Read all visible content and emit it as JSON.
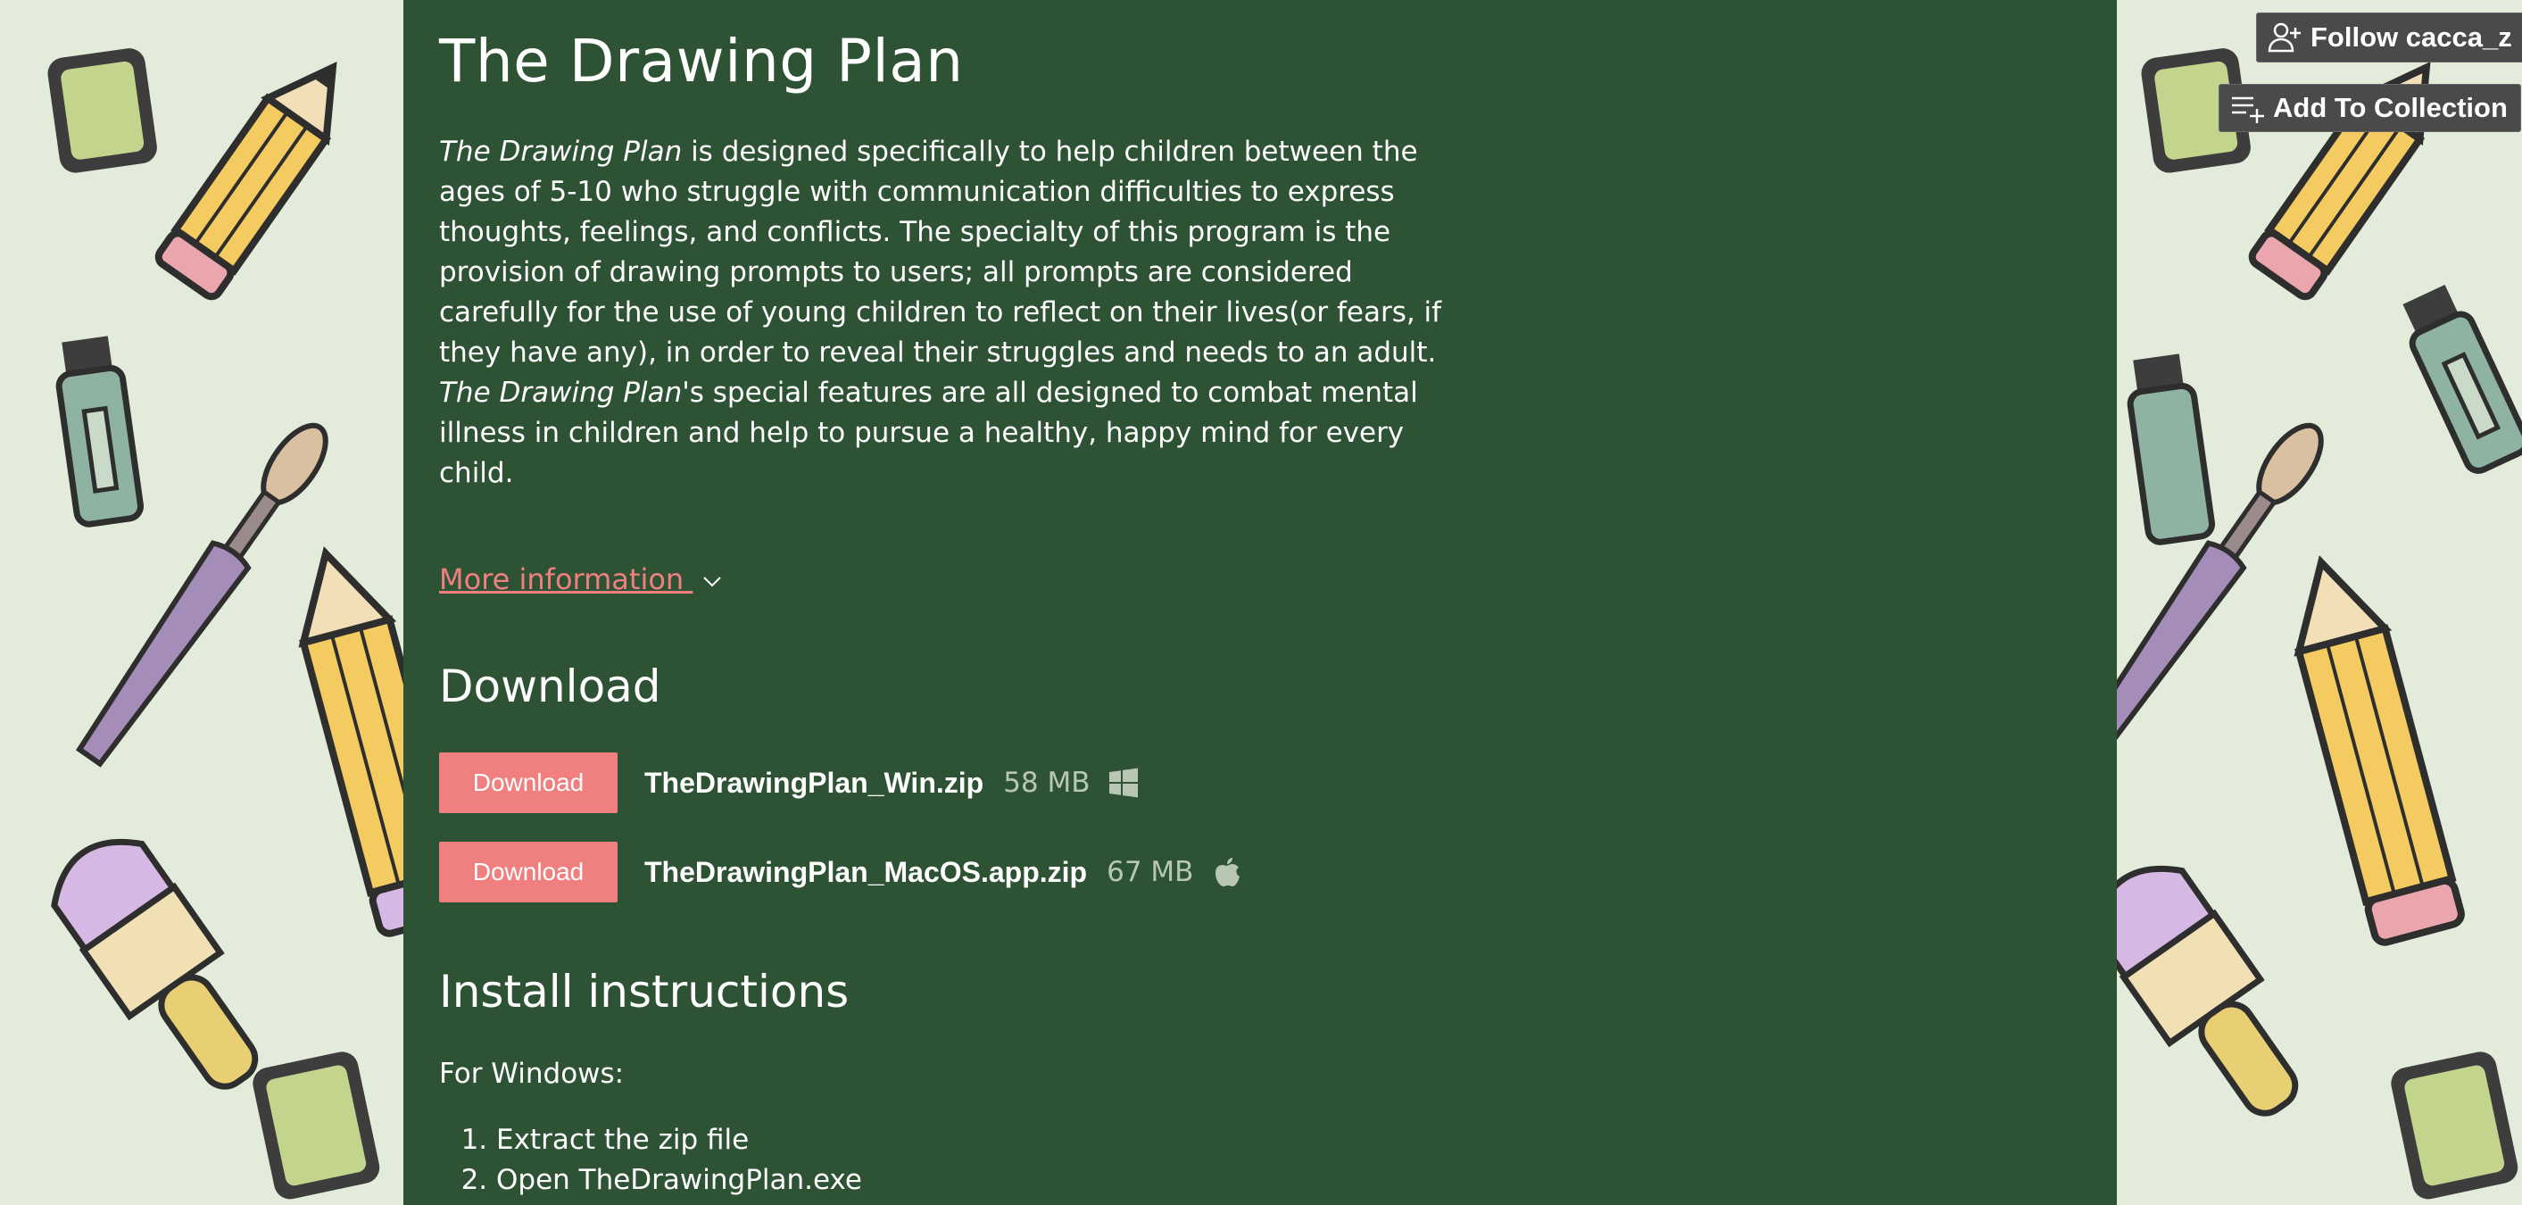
{
  "page": {
    "title": "The Drawing Plan",
    "description_parts": [
      {
        "text": "The Drawing Plan",
        "italic": true
      },
      {
        "text": " is designed specifically to help children between the ages of 5-10 who struggle with communication difficulties to express thoughts, feelings, and conflicts. The specialty of this program is the provision of drawing prompts to users; all prompts are considered carefully for the use of young children to reflect on their lives(or fears, if they have any), in order to reveal their struggles and needs to an adult. ",
        "italic": false
      },
      {
        "text": "The Drawing Plan",
        "italic": true
      },
      {
        "text": "'s special features are all designed to combat mental illness in children and help to pursue a healthy, happy mind for every child.",
        "italic": false
      }
    ],
    "more_info_label": "More information"
  },
  "download": {
    "heading": "Download",
    "files": [
      {
        "button_label": "Download",
        "filename": "TheDrawingPlan_Win.zip",
        "size": "58 MB",
        "os_icon": "windows-icon"
      },
      {
        "button_label": "Download",
        "filename": "TheDrawingPlan_MacOS.app.zip",
        "size": "67 MB",
        "os_icon": "apple-icon"
      }
    ]
  },
  "install": {
    "heading": "Install instructions",
    "for_windows": "For Windows:",
    "steps": [
      "Extract the zip file",
      "Open TheDrawingPlan.exe"
    ]
  },
  "actions": {
    "follow_label": "Follow cacca_z",
    "collection_label": "Add To Collection"
  },
  "colors": {
    "column_bg": "#2d5234",
    "page_bg": "#e3ecda",
    "accent": "#f08080",
    "muted_text": "#b7c7b3"
  }
}
